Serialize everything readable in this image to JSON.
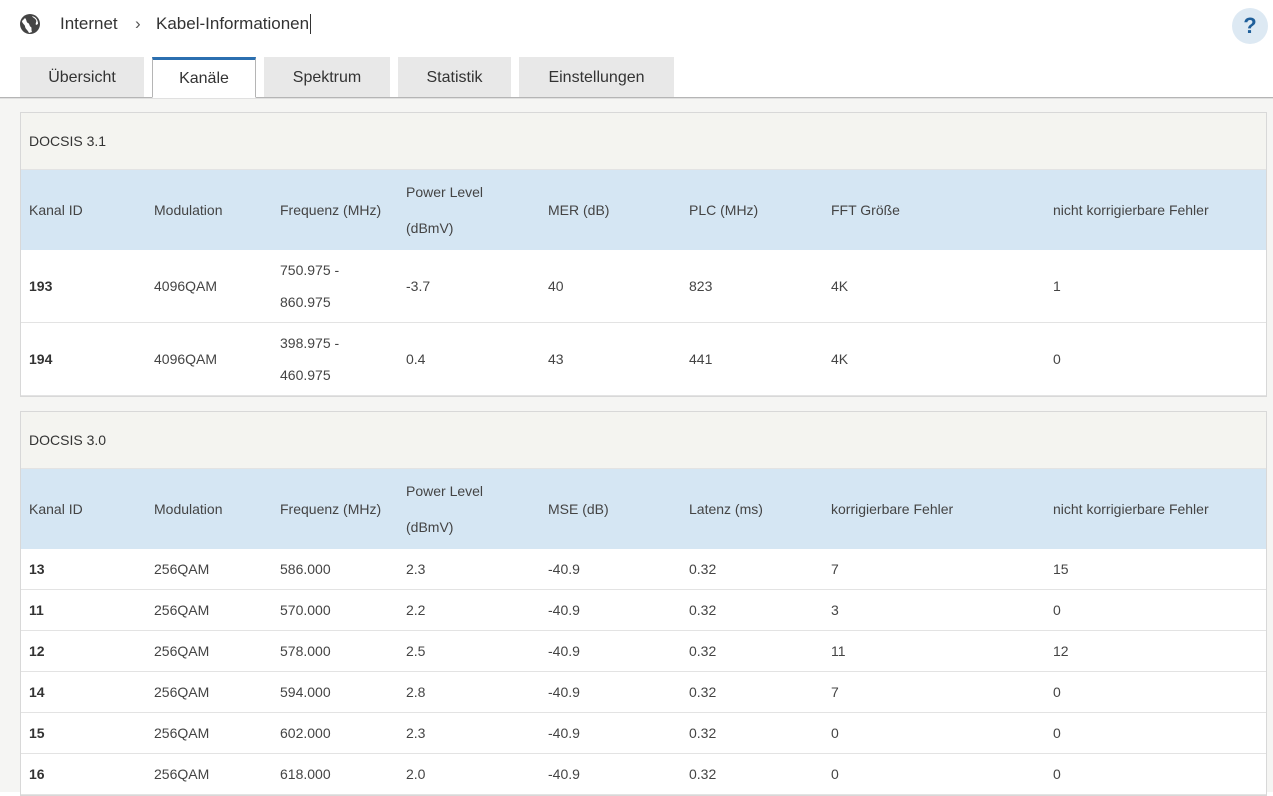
{
  "breadcrumb": {
    "root": "Internet",
    "separator": "›",
    "current": "Kabel-Informationen"
  },
  "help_label": "?",
  "tabs": [
    "Übersicht",
    "Kanäle",
    "Spektrum",
    "Statistik",
    "Einstellungen"
  ],
  "active_tab": "Kanäle",
  "docsis31": {
    "title": "DOCSIS 3.1",
    "headers": [
      "Kanal ID",
      "Modulation",
      "Frequenz (MHz)",
      "Power Level (dBmV)",
      "MER (dB)",
      "PLC (MHz)",
      "FFT Größe",
      "nicht korrigierbare Fehler"
    ],
    "rows": [
      [
        "193",
        "4096QAM",
        "750.975 - 860.975",
        "-3.7",
        "40",
        "823",
        "4K",
        "1"
      ],
      [
        "194",
        "4096QAM",
        "398.975 - 460.975",
        "0.4",
        "43",
        "441",
        "4K",
        "0"
      ]
    ]
  },
  "docsis30": {
    "title": "DOCSIS 3.0",
    "headers": [
      "Kanal ID",
      "Modulation",
      "Frequenz (MHz)",
      "Power Level (dBmV)",
      "MSE (dB)",
      "Latenz (ms)",
      "korrigierbare Fehler",
      "nicht korrigierbare Fehler"
    ],
    "rows": [
      [
        "13",
        "256QAM",
        "586.000",
        "2.3",
        "-40.9",
        "0.32",
        "7",
        "15"
      ],
      [
        "11",
        "256QAM",
        "570.000",
        "2.2",
        "-40.9",
        "0.32",
        "3",
        "0"
      ],
      [
        "12",
        "256QAM",
        "578.000",
        "2.5",
        "-40.9",
        "0.32",
        "11",
        "12"
      ],
      [
        "14",
        "256QAM",
        "594.000",
        "2.8",
        "-40.9",
        "0.32",
        "7",
        "0"
      ],
      [
        "15",
        "256QAM",
        "602.000",
        "2.3",
        "-40.9",
        "0.32",
        "0",
        "0"
      ],
      [
        "16",
        "256QAM",
        "618.000",
        "2.0",
        "-40.9",
        "0.32",
        "0",
        "0"
      ]
    ]
  },
  "colors": {
    "accent": "#2b6fb0",
    "header_row": "#d5e6f3",
    "section_head": "#f4f4f0"
  },
  "icons": {
    "breadcrumb": "globe-icon",
    "help": "help-icon"
  }
}
